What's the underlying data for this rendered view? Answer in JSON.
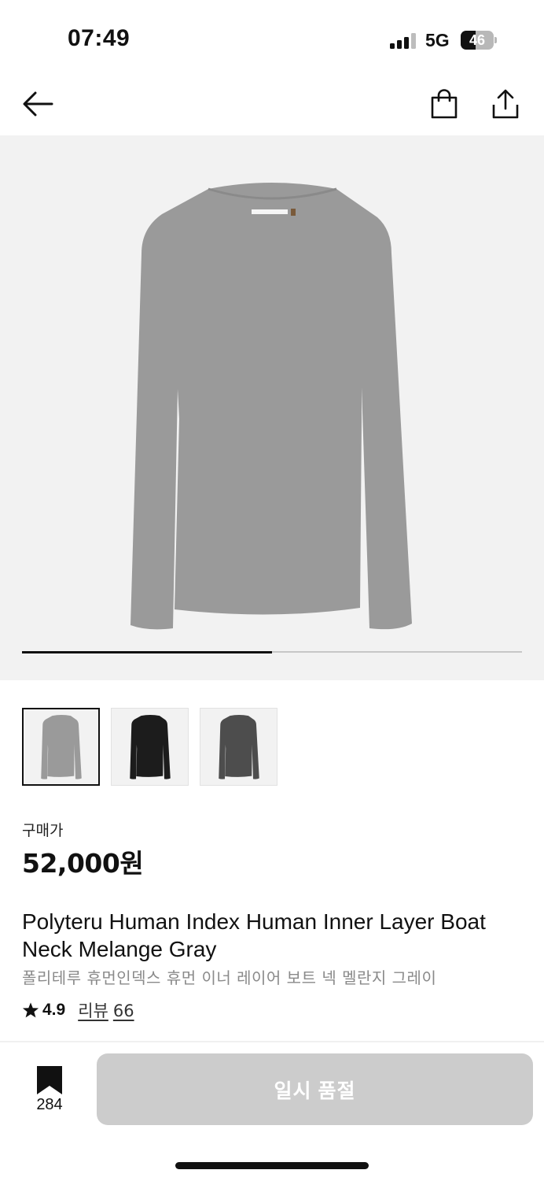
{
  "status_bar": {
    "time": "07:49",
    "network": "5G",
    "battery_percent": "46",
    "battery_level": 0.46,
    "signal_bars_active": 3,
    "signal_bars_total": 4
  },
  "nav": {
    "back_icon": "arrow-left-icon",
    "bag_icon": "shopping-bag-icon",
    "share_icon": "share-icon"
  },
  "gallery": {
    "progress_fraction": 0.5,
    "main_color": "#9a9a9a",
    "thumbnails": [
      {
        "color": "#9a9a9a",
        "selected": true
      },
      {
        "color": "#1c1c1c",
        "selected": false
      },
      {
        "color": "#4d4d4d",
        "selected": false
      }
    ]
  },
  "product": {
    "price_label": "구매가",
    "price": "52,000원",
    "title_en": "Polyteru Human Index Human Inner Layer Boat Neck Melange Gray",
    "title_ko": "폴리테루 휴먼인덱스 휴먼 이너 레이어 보트 넥 멜란지 그레이",
    "rating": "4.9",
    "review_label": "리뷰",
    "review_count": "66",
    "star_icon": "star-icon"
  },
  "bottom_bar": {
    "bookmark_icon": "bookmark-icon",
    "bookmark_count": "284",
    "buy_button_label": "일시 품절",
    "buy_button_color": "#cccccc"
  }
}
